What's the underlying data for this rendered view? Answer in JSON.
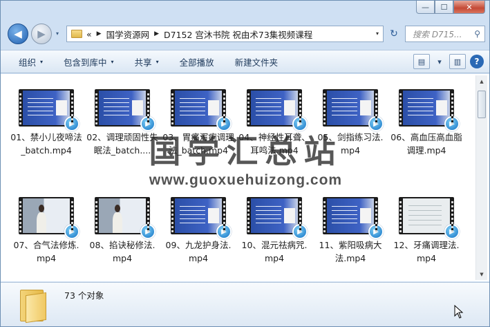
{
  "window": {
    "caption_buttons": {
      "minimize": "—",
      "maximize": "☐",
      "close": "✕"
    }
  },
  "nav": {
    "history_arrow": "▾",
    "breadcrumb": {
      "prefix": "«",
      "parts": [
        "国学资源网",
        "D7152 宫沐书院 祝由术73集视频课程"
      ],
      "sep": "▶"
    },
    "dropdown": "▾",
    "refresh": "↻",
    "search_placeholder": "搜索 D715..."
  },
  "toolbar": {
    "organize": "组织",
    "include_in_library": "包含到库中",
    "share": "共享",
    "play_all": "全部播放",
    "new_folder": "新建文件夹",
    "dd": "▾",
    "help": "?"
  },
  "files": [
    {
      "label": "01、禁小儿夜啼法_batch.mp4",
      "thumb": "slide"
    },
    {
      "label": "02、调理顽固性失眠法_batch....",
      "thumb": "slide"
    },
    {
      "label": "03、胃痛泻痢调理法_batch.mp4",
      "thumb": "slide"
    },
    {
      "label": "04、神经性耳聋、耳鸣法.mp4",
      "thumb": "slide"
    },
    {
      "label": "05、剑指练习法.mp4",
      "thumb": "slide"
    },
    {
      "label": "06、高血压高血脂调理.mp4",
      "thumb": "slide"
    },
    {
      "label": "07、合气法修炼.mp4",
      "thumb": "room"
    },
    {
      "label": "08、掐诀秘修法.mp4",
      "thumb": "room"
    },
    {
      "label": "09、九龙护身法.mp4",
      "thumb": "slide"
    },
    {
      "label": "10、混元祛病咒.mp4",
      "thumb": "slide"
    },
    {
      "label": "11、紫阳吸病大法.mp4",
      "thumb": "slide"
    },
    {
      "label": "12、牙痛调理法.mp4",
      "thumb": "board"
    }
  ],
  "status": {
    "count": "73 个对象"
  },
  "watermark": {
    "cn": "国学汇总站",
    "url": "www.guoxuehuizong.com"
  }
}
